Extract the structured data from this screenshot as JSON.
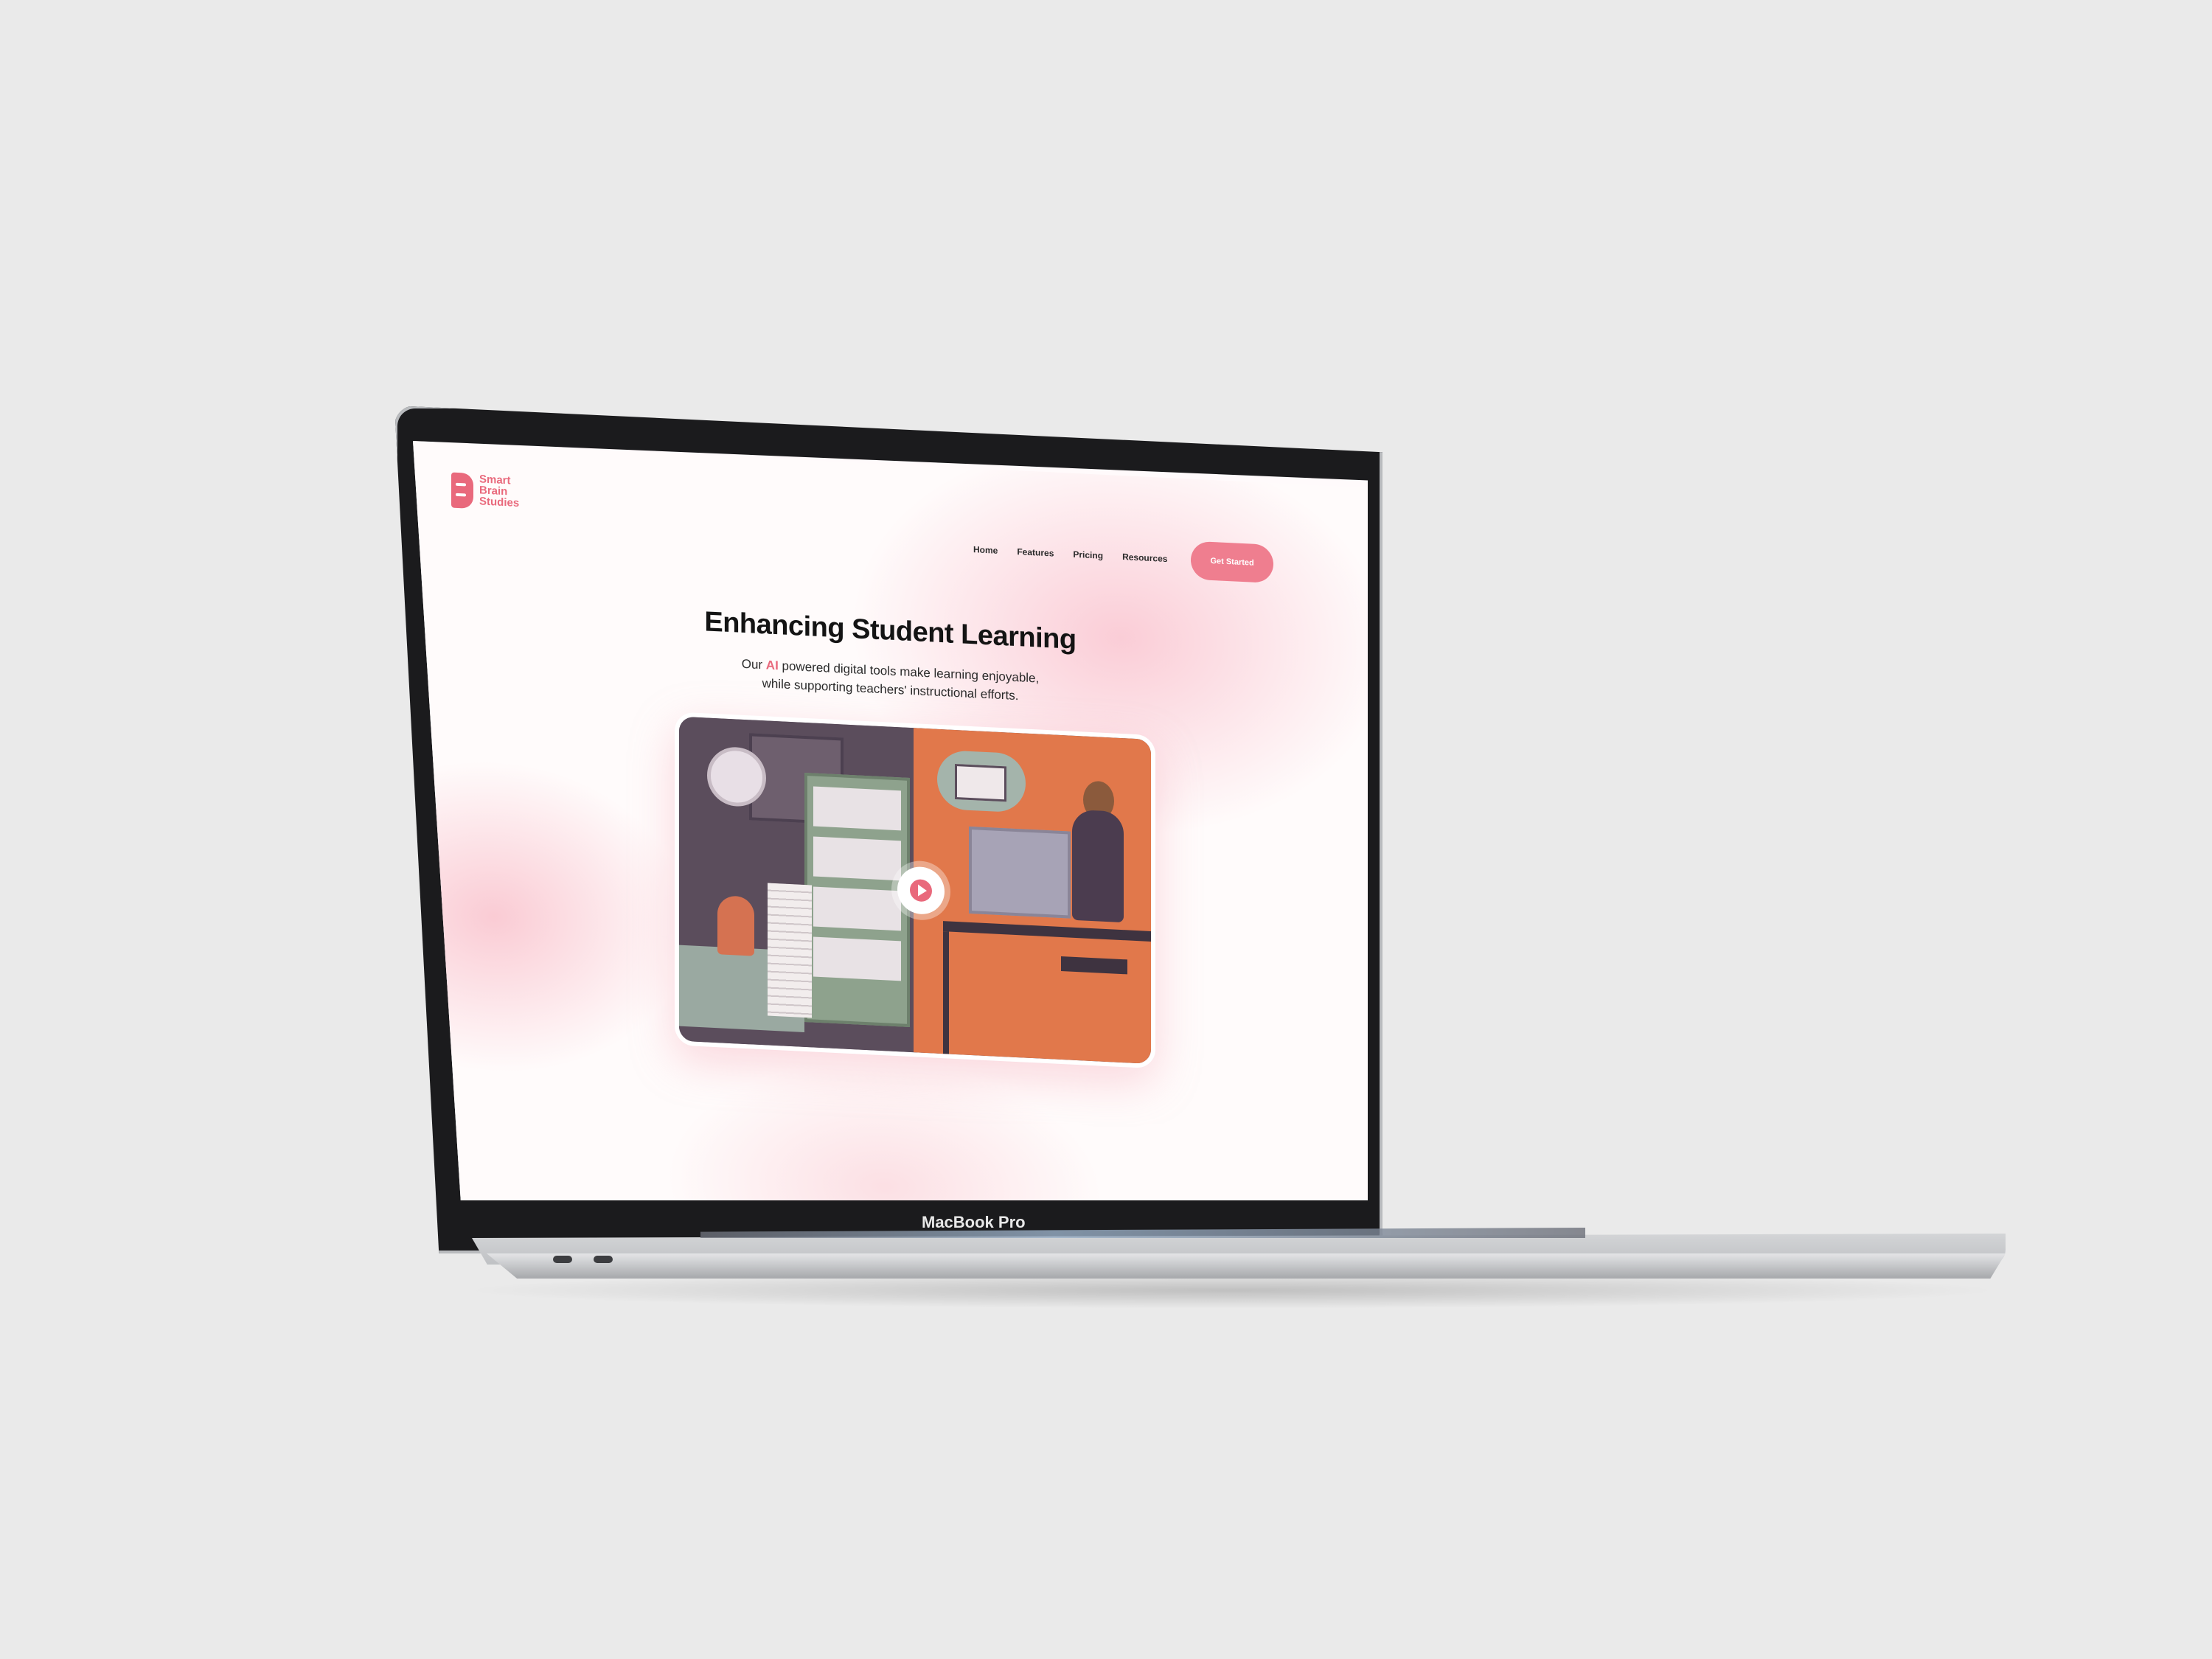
{
  "brand": {
    "line1": "Smart",
    "line2": "Brain",
    "line3": "Studies",
    "color": "#e9697c"
  },
  "nav": {
    "items": [
      "Home",
      "Features",
      "Pricing",
      "Resources"
    ],
    "cta_label": "Get Started",
    "cta_color": "#ef7e8f"
  },
  "hero": {
    "title": "Enhancing Student Learning",
    "sub_prefix": "Our ",
    "sub_highlight": "AI",
    "sub_rest_line1": " powered digital tools make learning enjoyable,",
    "sub_line2": "while supporting teachers' instructional efforts."
  },
  "video": {
    "play_icon": "play-icon"
  },
  "device": {
    "label": "MacBook Pro"
  }
}
